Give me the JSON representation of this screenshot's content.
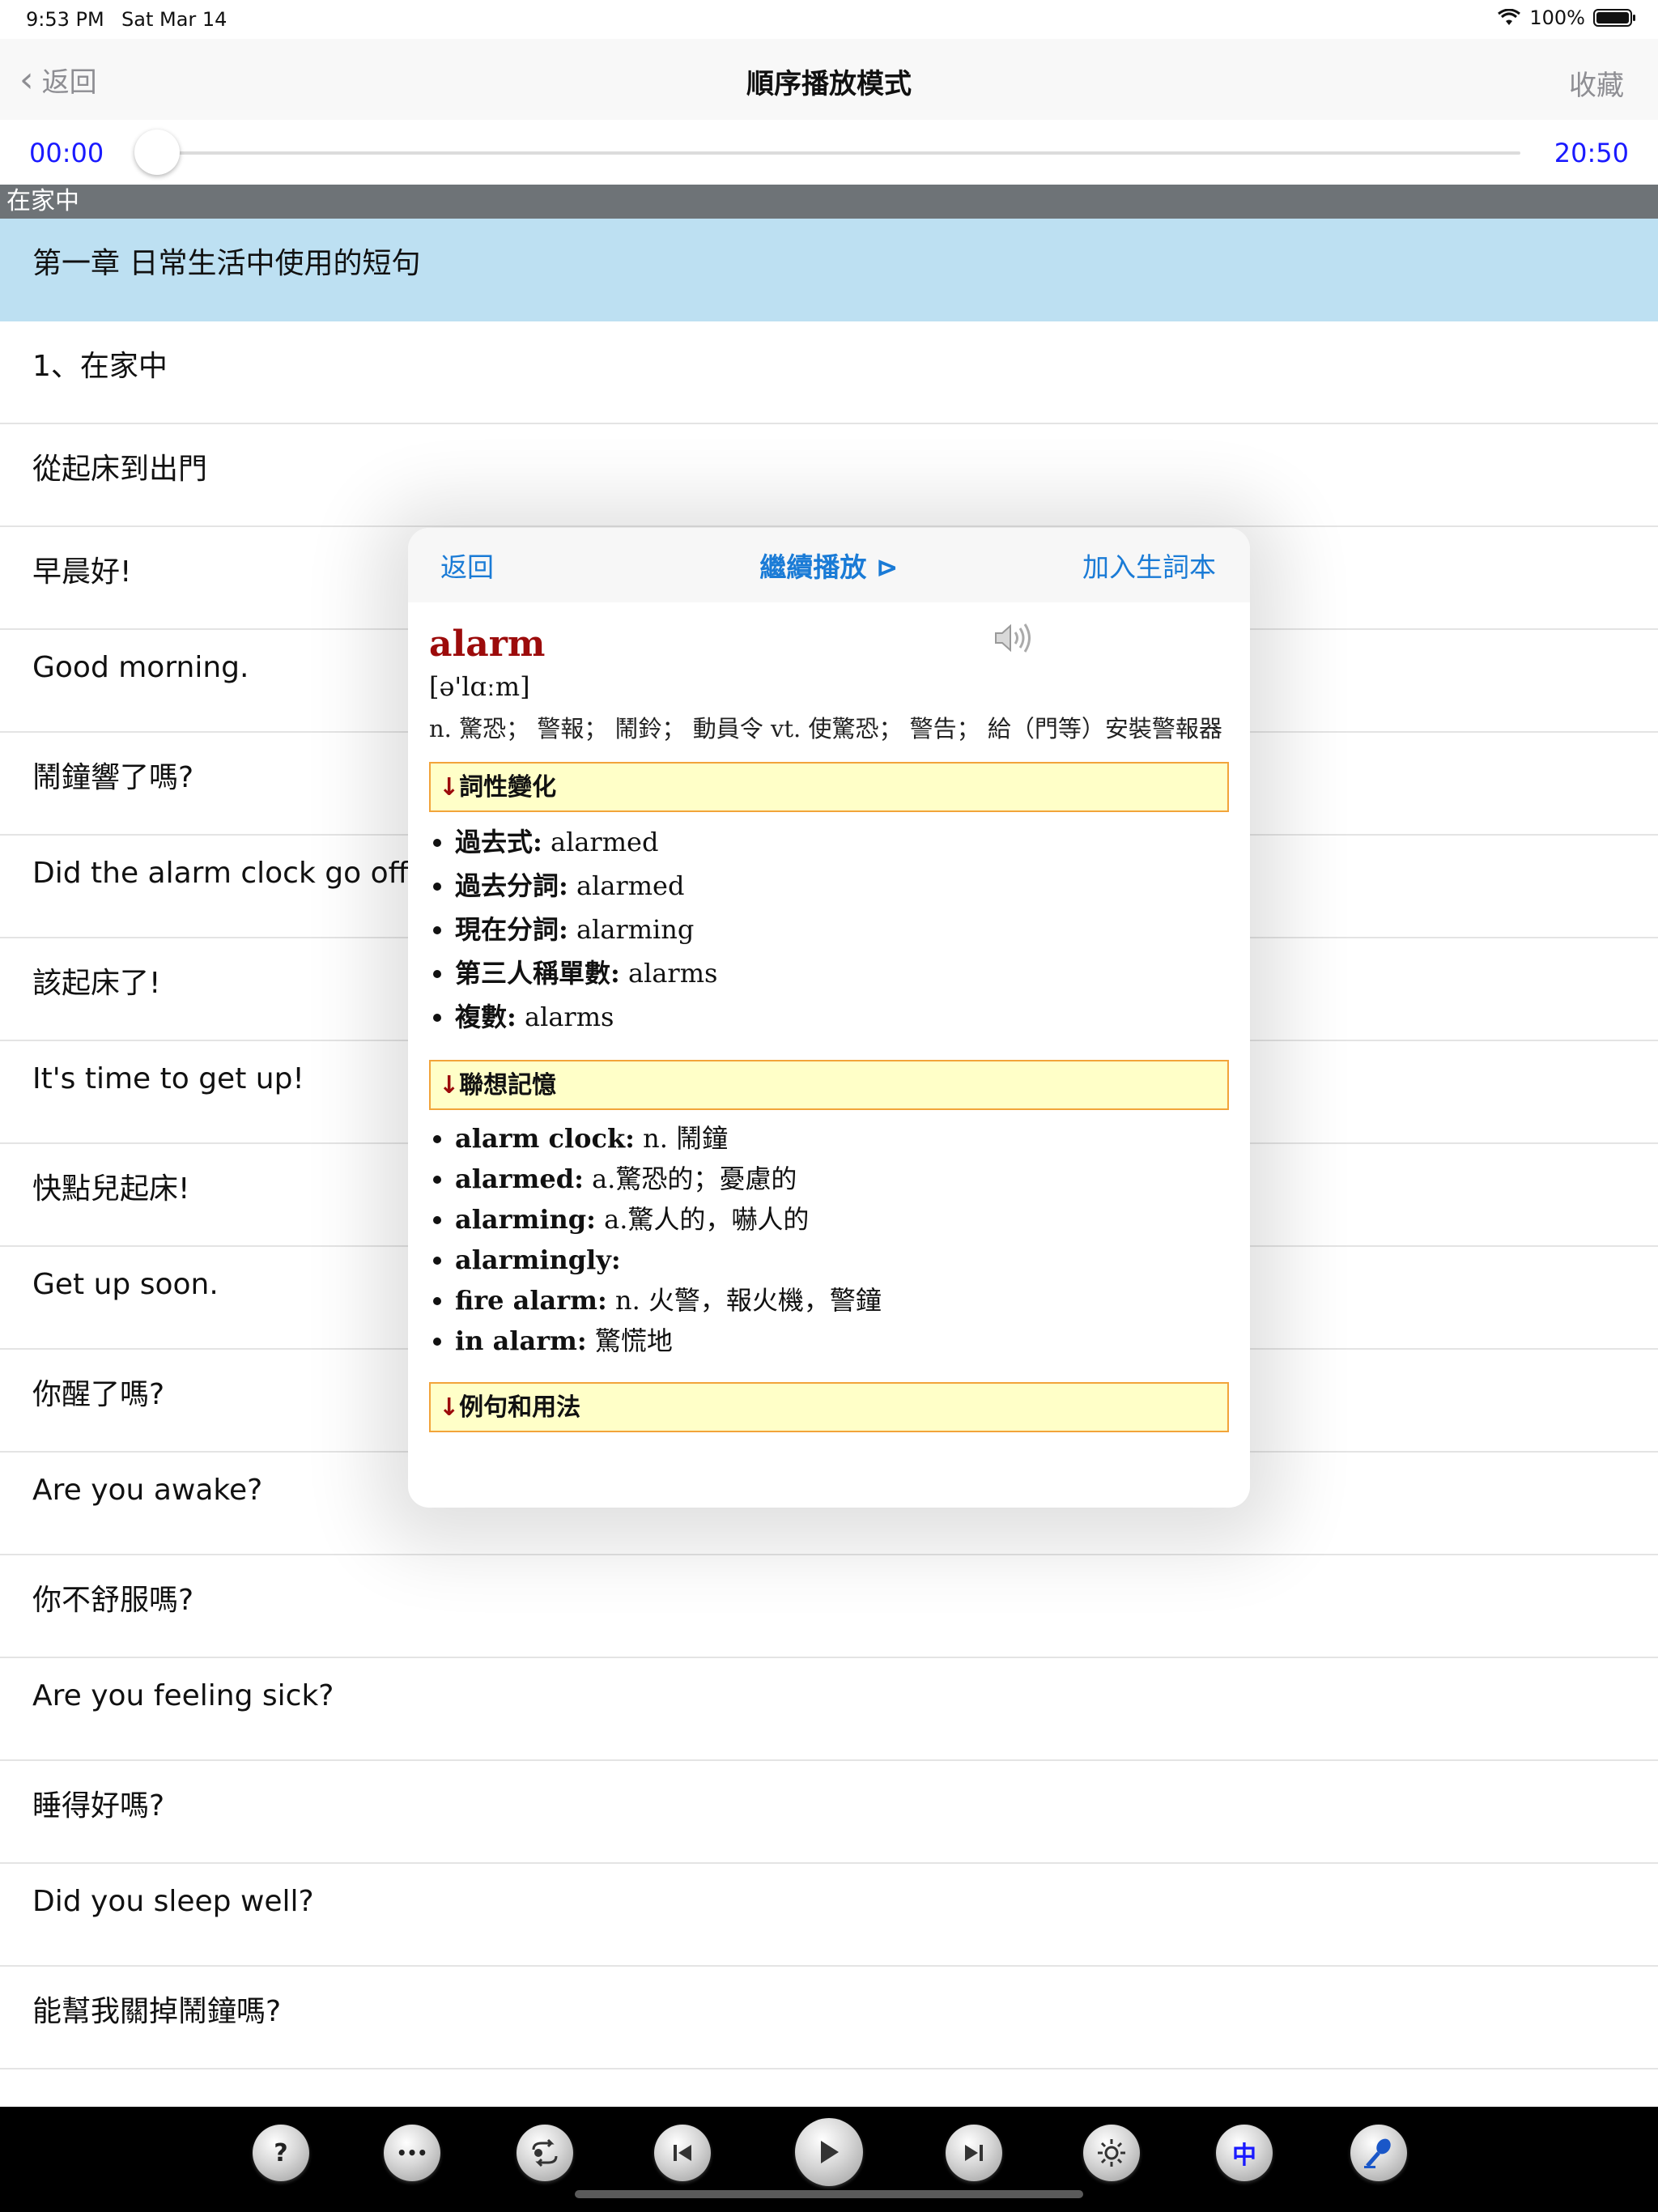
{
  "status": {
    "time": "9:53 PM",
    "date": "Sat Mar 14",
    "battery": "100%",
    "battery_level": 1.0
  },
  "nav": {
    "back": "返回",
    "title": "順序播放模式",
    "favorite": "收藏"
  },
  "player": {
    "elapsed": "00:00",
    "total": "20:50",
    "progress": 0.0
  },
  "section": "在家中",
  "rows": [
    "第一章 日常生活中使用的短句",
    "1、在家中",
    "從起床到出門",
    "早晨好!",
    "Good morning.",
    "鬧鐘響了嗎?",
    "Did the alarm clock go off?",
    "該起床了!",
    "It's time to get up!",
    "快點兒起床!",
    "Get up soon.",
    "你醒了嗎?",
    "Are you awake?",
    "你不舒服嗎?",
    "Are you feeling sick?",
    "睡得好嗎?",
    "Did you sleep well?",
    "能幫我關掉鬧鐘嗎?"
  ],
  "popup": {
    "back": "返回",
    "continue": "繼續播放 ⊳",
    "add": "加入生詞本",
    "word": "alarm",
    "phonetic": "[ə'lɑːm]",
    "meaning": "n. 驚恐； 警報； 鬧鈴； 動員令 vt. 使驚恐； 警告； 給（門等）安裝警報器",
    "sections": {
      "forms_title": "詞性變化",
      "forms": [
        {
          "label": "過去式:",
          "value": "alarmed"
        },
        {
          "label": "過去分詞:",
          "value": "alarmed"
        },
        {
          "label": "現在分詞:",
          "value": "alarming"
        },
        {
          "label": "第三人稱單數:",
          "value": "alarms"
        },
        {
          "label": "複數:",
          "value": "alarms"
        }
      ],
      "assoc_title": "聯想記憶",
      "assoc": [
        {
          "label": "alarm clock:",
          "value": "n. 鬧鐘"
        },
        {
          "label": "alarmed:",
          "value": "a.驚恐的；憂慮的"
        },
        {
          "label": "alarming:",
          "value": "a.驚人的，嚇人的"
        },
        {
          "label": "alarmingly:",
          "value": ""
        },
        {
          "label": "fire alarm:",
          "value": "n. 火警，報火機，警鐘"
        },
        {
          "label": "in alarm:",
          "value": "驚慌地"
        }
      ],
      "examples_title": "例句和用法",
      "arrow": "↓"
    }
  },
  "toolbar": {
    "help": "?",
    "more": "•••",
    "chinese": "中",
    "icons": [
      "help-icon",
      "more-icon",
      "repeat-icon",
      "previous-icon",
      "play-icon",
      "next-icon",
      "brightness-icon",
      "chinese-toggle-icon",
      "microphone-icon"
    ]
  }
}
